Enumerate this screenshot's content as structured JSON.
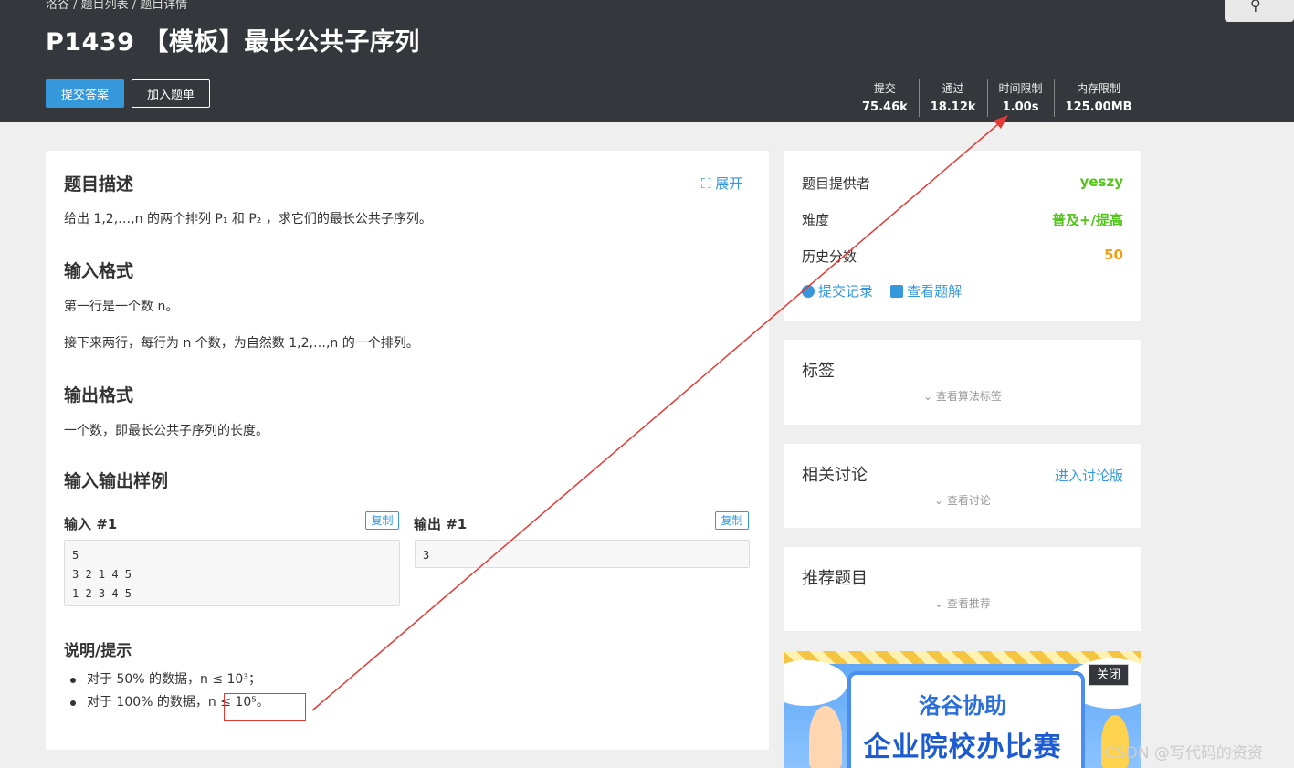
{
  "header": {
    "breadcrumb": "洛谷 / 题目列表 / 题目详情",
    "title": "P1439 【模板】最长公共子序列",
    "submit_label": "提交答案",
    "add_label": "加入题单",
    "stats": [
      {
        "label": "提交",
        "value": "75.46k"
      },
      {
        "label": "通过",
        "value": "18.12k"
      },
      {
        "label": "时间限制",
        "value": "1.00s"
      },
      {
        "label": "内存限制",
        "value": "125.00MB"
      }
    ]
  },
  "problem": {
    "desc_title": "题目描述",
    "expand_label": "展开",
    "desc_text": "给出 1,2,…,n 的两个排列 P₁ 和 P₂ ，求它们的最长公共子序列。",
    "input_title": "输入格式",
    "input_line1": "第一行是一个数 n。",
    "input_line2": "接下来两行，每行为 n 个数，为自然数 1,2,…,n 的一个排列。",
    "output_title": "输出格式",
    "output_text": "一个数，即最长公共子序列的长度。",
    "samples_title": "输入输出样例",
    "sample_in_label": "输入 #1",
    "sample_out_label": "输出 #1",
    "copy_label": "复制",
    "sample_in": "5\n3 2 1 4 5\n1 2 3 4 5",
    "sample_out": "3",
    "hint_title": "说明/提示",
    "hint1": "对于 50% 的数据，n ≤ 10³；",
    "hint2": "对于 100% 的数据，n ≤ 10⁵。"
  },
  "info": {
    "provider_label": "题目提供者",
    "provider_value": "yeszy",
    "difficulty_label": "难度",
    "difficulty_value": "普及+/提高",
    "score_label": "历史分数",
    "score_value": "50",
    "records_label": "提交记录",
    "solutions_label": "查看题解"
  },
  "tags": {
    "title": "标签",
    "more": "查看算法标签"
  },
  "discuss": {
    "title": "相关讨论",
    "enter": "进入讨论版",
    "more": "查看讨论"
  },
  "recommend": {
    "title": "推荐题目",
    "more": "查看推荐"
  },
  "ad": {
    "line1": "洛谷协助",
    "line2": "企业院校办比赛",
    "close": "关闭"
  },
  "watermark": "CSDN @写代码的资资",
  "colors": {
    "accent": "#3498db",
    "green": "#52c41a",
    "orange": "#f39c11",
    "arrow": "#e53935",
    "header": "#34373b"
  }
}
